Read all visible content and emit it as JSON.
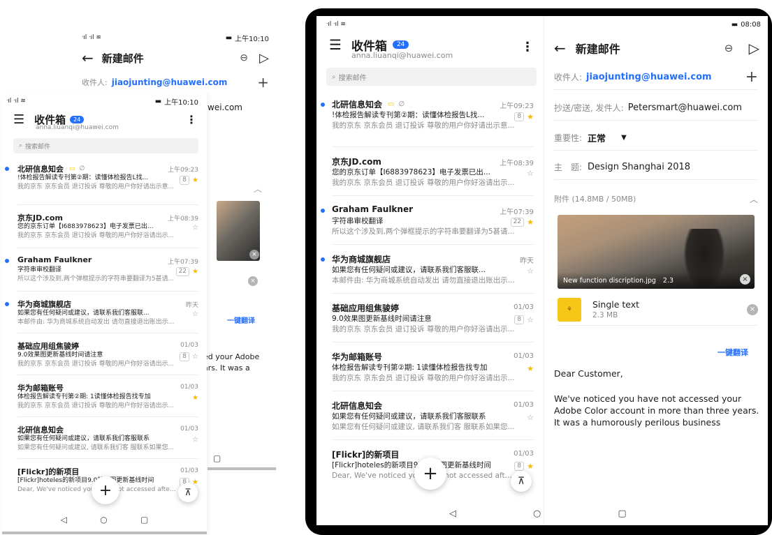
{
  "colors": {
    "accent": "#256fff",
    "star": "#f8b900",
    "unread_dot": "#256fff"
  },
  "inbox": {
    "title": "收件箱",
    "unread_count": "24",
    "account": "anna.liuanqi@huawei.com",
    "search_placeholder": "搜索邮件",
    "emails": [
      {
        "from": "北研信息知会",
        "time": "上午09:23",
        "subject": "!体检报告解读专刊第②期：读懂体检报告L找...",
        "preview": "我的京东 京东会员 退订投诉 尊敬的用户你好请出示意...",
        "unread": true,
        "count": "8",
        "starred": true,
        "has_flag_icons": true
      },
      {
        "from": "京东JD.com",
        "time": "上午08:39",
        "subject": "您的京东订单【I6883978623】电子发票已出...",
        "preview": "我的京东 京东会员 退订投诉 尊敬的用户你好浴请出示...",
        "unread": false,
        "count": "",
        "starred": false
      },
      {
        "from": "Graham Faulkner",
        "time": "上午07:39",
        "subject": "字符串审校翻译",
        "preview": "所以这个涉及到,两个弹框提示的字符串要翻译为5甚请...",
        "unread": true,
        "count": "22",
        "starred": true
      },
      {
        "from": "华为商城旗舰店",
        "time": "昨天",
        "subject": "如果您有任何疑问或建议，请联系我们客服联...",
        "preview": "本邮件由: 华为商城系统自动发出 请勿直接退出账出示...",
        "unread": true,
        "count": "",
        "starred": false
      },
      {
        "from": "基础应用组焦骏婷",
        "time": "01/03",
        "subject": "9.0效果图更新基线时间请注意",
        "preview": "我的京东 京东会员 退订投诉 尊敬的用户你好浴请出示...",
        "unread": false,
        "count": "8",
        "starred": false
      },
      {
        "from": "华为邮箱账号",
        "time": "01/03",
        "subject": "体检报告解读专刊第②期: 1读懂体检报告找专加",
        "preview": "我的京东 京东会员 退订投诉 尊敬的用户你好浴请出示...",
        "unread": false,
        "count": "",
        "starred": true
      },
      {
        "from": "北研信息知会",
        "time": "01/03",
        "subject": "如果您有任何疑问或建议，请联系我们客服联系",
        "preview": "如果您有任何疑问或建议, 请联系我们客 服联系如果您...",
        "unread": false,
        "count": "",
        "starred": false
      },
      {
        "from": "[Flickr]的新项目",
        "time": "01/03",
        "subject": "[Flickr]hoteles的新项目9.0效果图更新基线时间",
        "preview": "Dear, We've noticed you have not accessed after them",
        "unread": false,
        "count": "8",
        "starred": true
      }
    ],
    "phone_status_time": "上午10:10",
    "tablet_status_time": "08:08"
  },
  "compose": {
    "title": "新建邮件",
    "to_label": "收件人:",
    "to_value": "jiaojunting@huawei.com",
    "cc_label": "抄送/密送, 发件人:",
    "cc_value": "Petersmart@huawei.com",
    "importance_label": "重要性:",
    "importance_value": "正常",
    "subject_label": "主　题:",
    "subject_value": "Design Shanghai 2018",
    "attachments_label": "附件 (14.8MB / 50MB)",
    "image_attachment": "New function discription.jpg",
    "image_attachment_size": "2.3",
    "file_name": "Single text",
    "file_size": "2.3 MB",
    "translate_button": "一键翻译",
    "greeting": "Dear Customer,",
    "body": "We've noticed you have not accessed your Adobe Color account in more than three years. It was a humorously perilous business",
    "back_partial_cc": "wei.com",
    "back_partial_body_1": "ed your Adobe",
    "back_partial_body_2": "ars. It was a"
  }
}
